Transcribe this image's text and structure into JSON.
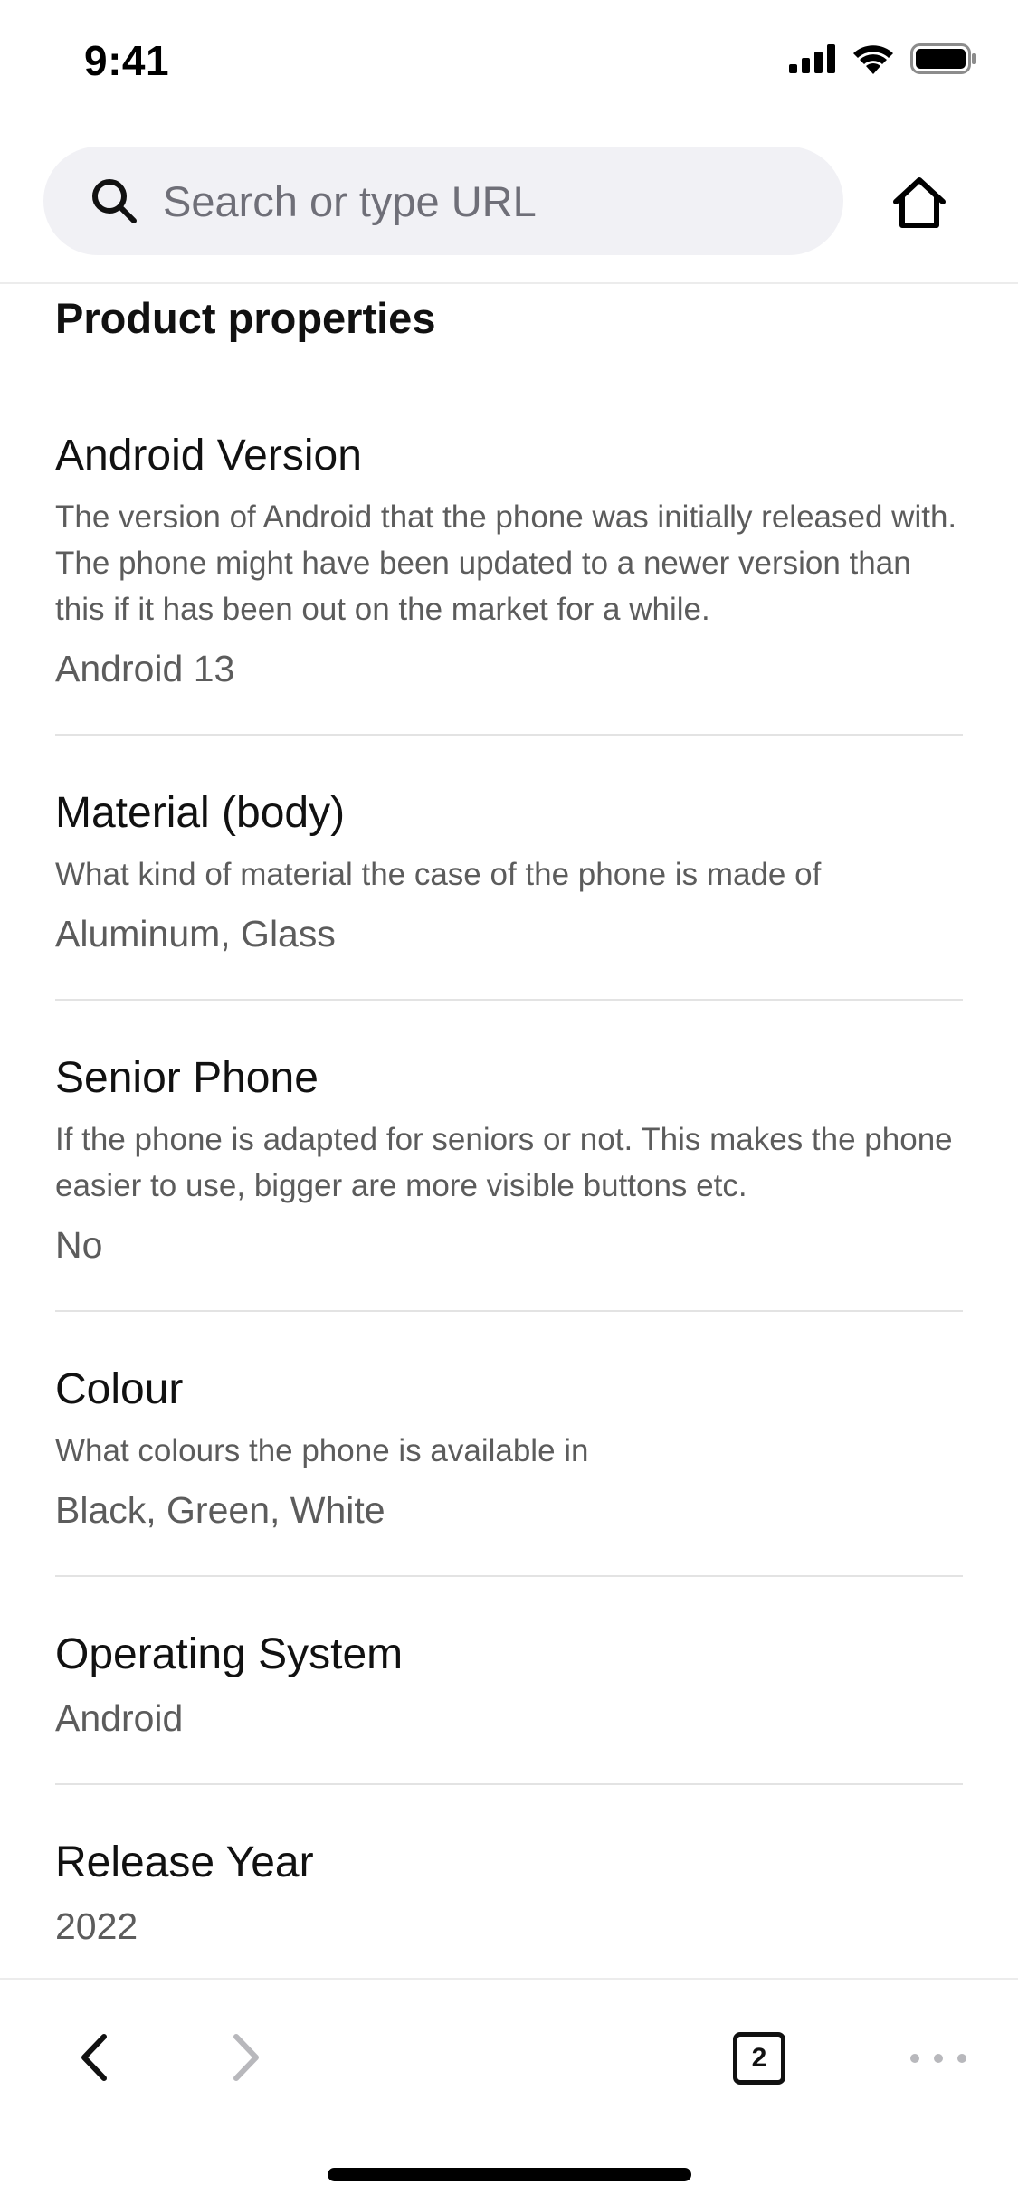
{
  "status_bar": {
    "time": "9:41"
  },
  "browser": {
    "search_placeholder": "Search or type URL",
    "tab_count": "2"
  },
  "page": {
    "section_title": "Product properties",
    "properties": [
      {
        "name": "Android Version",
        "description": "The version of Android that the phone was initially released with. The phone might have been updated to a newer version than this if it has been out on the market for a while.",
        "value": "Android 13"
      },
      {
        "name": "Material (body)",
        "description": "What kind of material the case of the phone is made of",
        "value": "Aluminum, Glass"
      },
      {
        "name": "Senior Phone",
        "description": "If the phone is adapted for seniors or not. This makes the phone easier to use, bigger are more visible buttons etc.",
        "value": "No"
      },
      {
        "name": "Colour",
        "description": "What colours the phone is available in",
        "value": "Black, Green, White"
      },
      {
        "name": "Operating System",
        "description": "",
        "value": "Android"
      },
      {
        "name": "Release Year",
        "description": "",
        "value": "2022"
      }
    ]
  },
  "icons": {
    "signal": "cellular-signal-icon",
    "wifi": "wifi-icon",
    "battery": "battery-icon",
    "search": "search-icon",
    "home": "home-icon",
    "back": "chevron-left-icon",
    "forward": "chevron-right-icon",
    "tabs": "tabs-icon",
    "more": "more-dots-icon"
  },
  "colors": {
    "search_bar_bg": "#f1f1f5",
    "disabled_icon": "#b8b8bc",
    "muted_text": "#5c5c5c"
  }
}
